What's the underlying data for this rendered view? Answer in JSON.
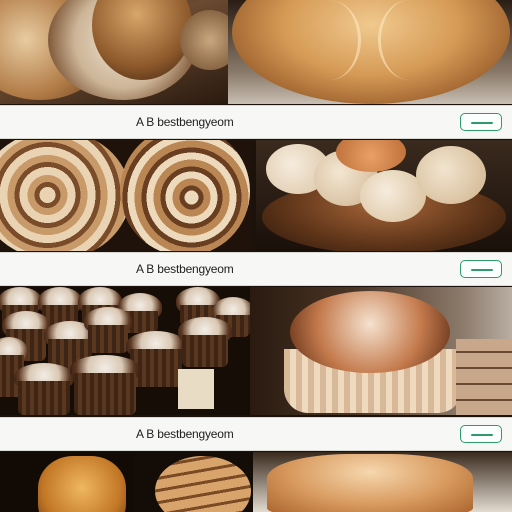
{
  "feed": {
    "cards": [
      {
        "label": "A B bestbengyeom",
        "images": [
          "crusty-sourdough-loaves-image",
          "large-rustic-boule-image"
        ]
      },
      {
        "label": "A B bestbengyeom",
        "images": [
          "swirled-bread-rolls-image",
          "pull-apart-bread-bowl-image"
        ]
      },
      {
        "label": "A B bestbengyeom",
        "images": [
          "frosted-muffin-tray-image",
          "giant-muffin-image"
        ]
      }
    ]
  },
  "colors": {
    "accent": "#2f9b6a",
    "bar": "#f7f7f5",
    "background": "#1a120b"
  }
}
